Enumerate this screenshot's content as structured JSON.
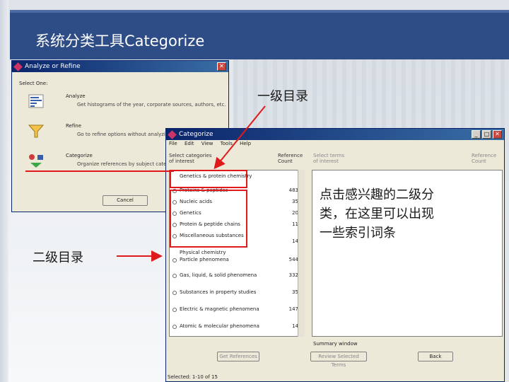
{
  "slide": {
    "title": "系统分类工具Categorize"
  },
  "annotations": {
    "level1": "一级目录",
    "level2": "二级目录",
    "note_line1": "点击感兴趣的二级分",
    "note_line2": "类，在这里可以出现",
    "note_line3": "一些索引词条"
  },
  "analyze_window": {
    "title": "Analyze or Refine",
    "prompt": "Select One:",
    "options": [
      {
        "title": "Analyze",
        "desc": "Get histograms of the year, corporate sources, authors, etc.",
        "icon": "histogram-icon"
      },
      {
        "title": "Refine",
        "desc": "Go to refine options without analyzing the",
        "icon": "funnel-icon"
      },
      {
        "title": "Categorize",
        "desc": "Organize references by subject categor",
        "icon": "categorize-icon"
      }
    ],
    "cancel_label": "Cancel"
  },
  "categorize_window": {
    "title": "Categorize",
    "menu": [
      "File",
      "Edit",
      "View",
      "Tools",
      "Help"
    ],
    "col_select_categories": "Select categories",
    "col_current": "of interest",
    "col_ref_count": "Reference",
    "col_count": "Count",
    "col_select_terms": "Select terms",
    "col_terms_current": "of interest",
    "col_ref_count2": "Reference",
    "col_count2": "Count",
    "categories": [
      {
        "label": "Genetics & protein chemistry",
        "count": "",
        "header": true
      },
      {
        "label": "Proteins & peptides",
        "count": "483"
      },
      {
        "label": "Nucleic acids",
        "count": "35"
      },
      {
        "label": "Genetics",
        "count": "20"
      },
      {
        "label": "Protein & peptide chains",
        "count": "11"
      },
      {
        "label": "Miscellaneous substances",
        "count": "14"
      },
      {
        "label": "Physical chemistry",
        "count": "",
        "header": true
      },
      {
        "label": "Particle phenomena",
        "count": "544"
      },
      {
        "label": "Gas, liquid, & solid phenomena",
        "count": "332"
      },
      {
        "label": "Substances in property studies",
        "count": "35"
      },
      {
        "label": "Electric & magnetic phenomena",
        "count": "147"
      },
      {
        "label": "Atomic & molecular phenomena",
        "count": "14"
      }
    ],
    "summary_label": "Summary window",
    "btn_get_refs": "Get References",
    "btn_review": "Review Selected Terms",
    "btn_back": "Back",
    "status": "Selected: 1-10 of 15"
  },
  "colors": {
    "title_band": "#2e4d86",
    "annotation_red": "#e01a1a"
  }
}
